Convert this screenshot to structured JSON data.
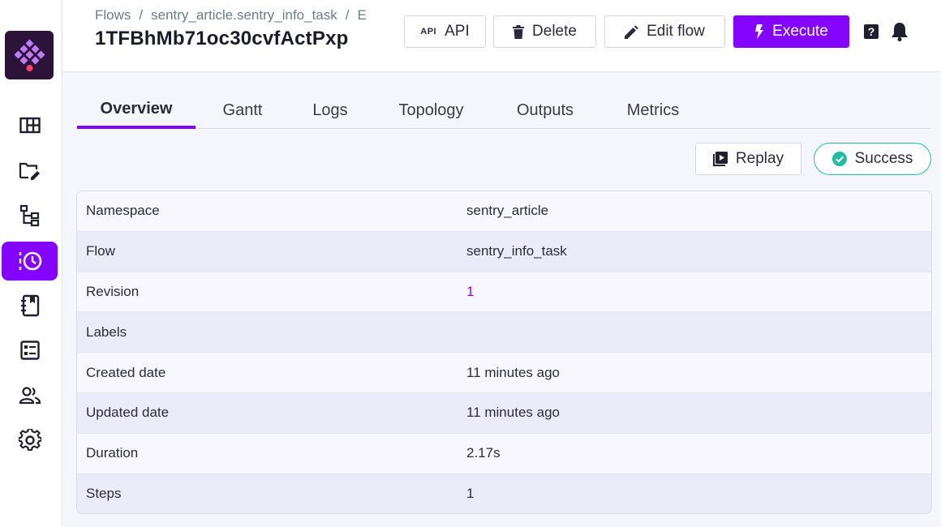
{
  "header": {
    "breadcrumb": [
      "Flows",
      "sentry_article.sentry_info_task",
      "E"
    ],
    "title": "1TFBhMb71oc30cvfActPxp"
  },
  "toolbar": {
    "api_glyph": "API",
    "api_label": "API",
    "delete_label": "Delete",
    "edit_label": "Edit flow",
    "execute_label": "Execute",
    "help_glyph": "?"
  },
  "tabs": [
    {
      "label": "Overview",
      "active": true
    },
    {
      "label": "Gantt"
    },
    {
      "label": "Logs"
    },
    {
      "label": "Topology"
    },
    {
      "label": "Outputs"
    },
    {
      "label": "Metrics"
    }
  ],
  "actions": {
    "replay_label": "Replay",
    "status_label": "Success"
  },
  "details": [
    {
      "key": "Namespace",
      "value": "sentry_article"
    },
    {
      "key": "Flow",
      "value": "sentry_info_task"
    },
    {
      "key": "Revision",
      "value": "1"
    },
    {
      "key": "Labels",
      "value": ""
    },
    {
      "key": "Created date",
      "value": "11 minutes ago"
    },
    {
      "key": "Updated date",
      "value": "11 minutes ago"
    },
    {
      "key": "Duration",
      "value": "2.17s"
    },
    {
      "key": "Steps",
      "value": "1"
    }
  ],
  "sidebar": {
    "items": [
      "dashboard-icon",
      "flows-icon",
      "templates-icon",
      "executions-icon",
      "logs-icon",
      "blueprints-icon",
      "users-icon",
      "settings-icon"
    ],
    "active": "executions-icon"
  },
  "colors": {
    "accent": "#8405ff",
    "success": "#1fbf9f",
    "logo_bg": "#2b1339"
  }
}
